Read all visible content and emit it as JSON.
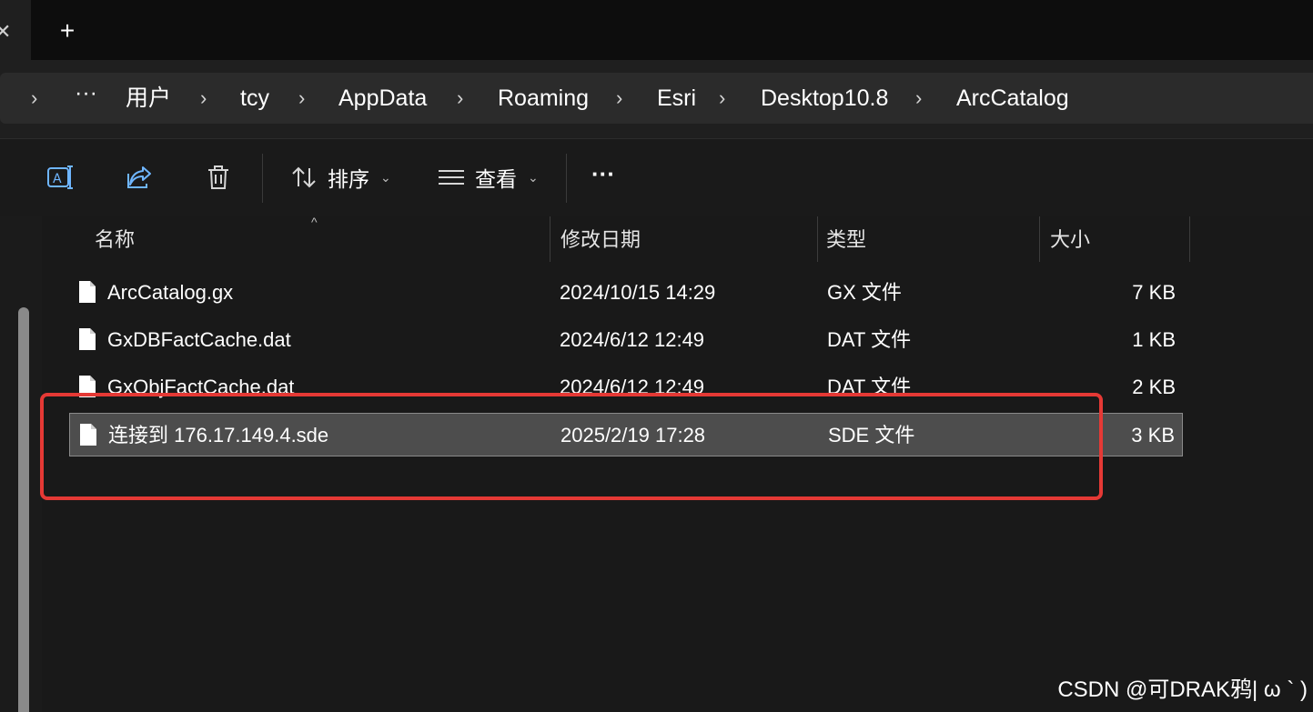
{
  "tab_bar": {
    "new_tab_label": "+",
    "close_label": "✕"
  },
  "breadcrumb": [
    {
      "label": "···"
    },
    {
      "label": "用户"
    },
    {
      "label": "tcy"
    },
    {
      "label": "AppData"
    },
    {
      "label": "Roaming"
    },
    {
      "label": "Esri"
    },
    {
      "label": "Desktop10.8"
    },
    {
      "label": "ArcCatalog"
    }
  ],
  "breadcrumb_separator": "›",
  "toolbar": {
    "sort_label": "排序",
    "view_label": "查看",
    "more_label": "···",
    "icons": [
      "rename-icon",
      "share-icon",
      "delete-icon",
      "sort-icon",
      "view-icon"
    ]
  },
  "columns": {
    "name": "名称",
    "modified": "修改日期",
    "type": "类型",
    "size": "大小"
  },
  "files": [
    {
      "name": "ArcCatalog.gx",
      "modified": "2024/10/15 14:29",
      "type": "GX 文件",
      "size": "7 KB"
    },
    {
      "name": "GxDBFactCache.dat",
      "modified": "2024/6/12 12:49",
      "type": "DAT 文件",
      "size": "1 KB"
    },
    {
      "name": "GxObjFactCache.dat",
      "modified": "2024/6/12 12:49",
      "type": "DAT 文件",
      "size": "2 KB"
    },
    {
      "name": "连接到 176.17.149.4.sde",
      "modified": "2025/2/19 17:28",
      "type": "SDE 文件",
      "size": "3 KB",
      "selected": true
    }
  ],
  "watermark": "CSDN @可DRAK鸦| ω ` )",
  "colors": {
    "background": "#191919",
    "selection": "#4d4d4d",
    "highlight_box": "#e53935"
  }
}
